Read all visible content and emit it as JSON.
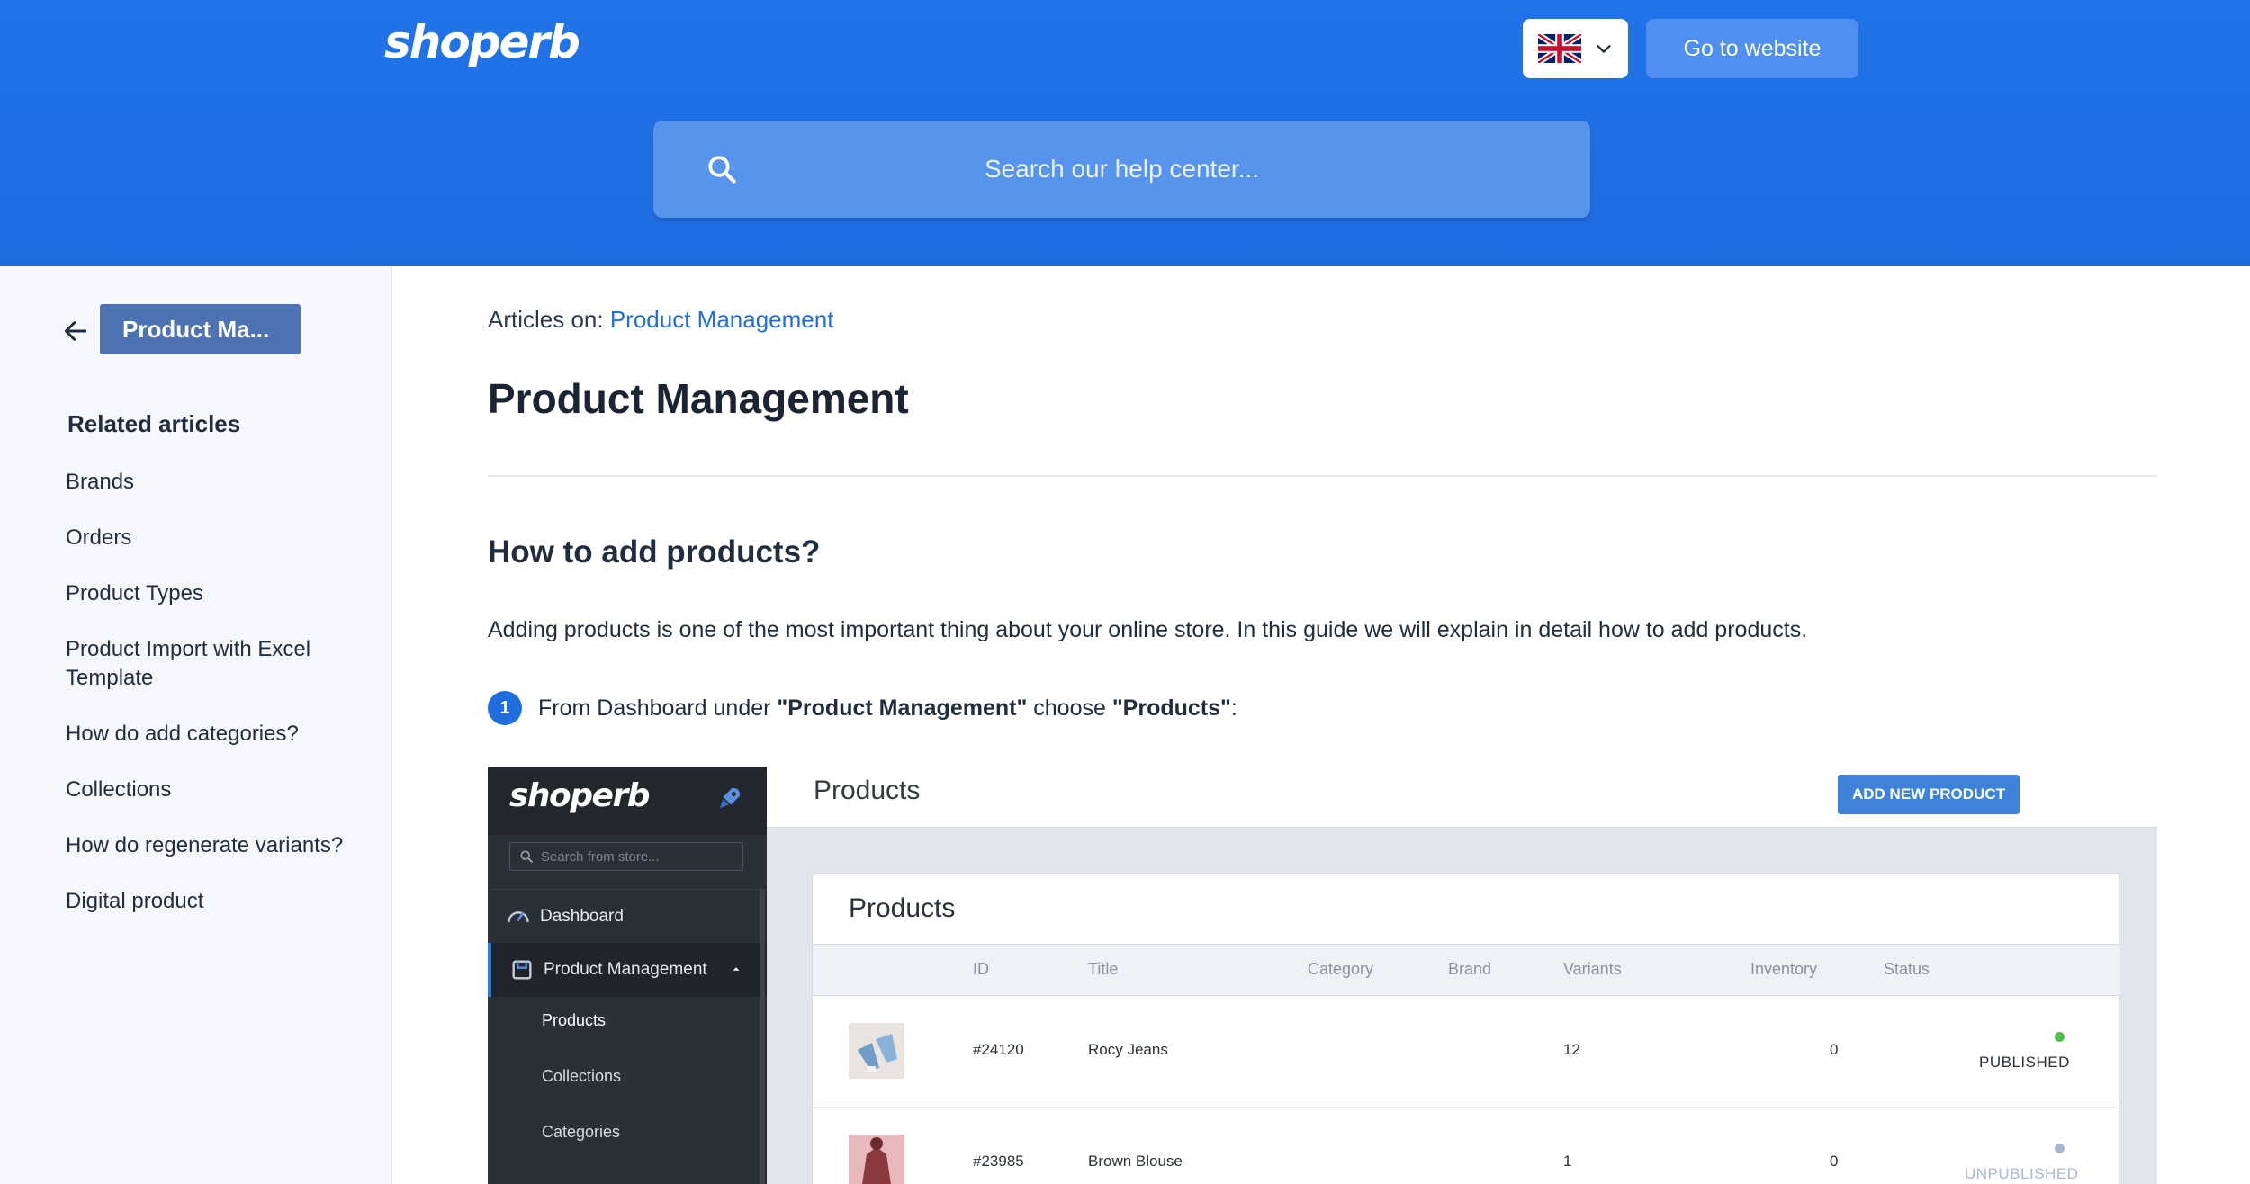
{
  "header": {
    "logo": "shoperb",
    "goto_label": "Go to website",
    "search_placeholder": "Search our help center..."
  },
  "sidebar": {
    "back_label": "Product Ma...",
    "related_title": "Related articles",
    "items": [
      "Brands",
      "Orders",
      "Product Types",
      "Product Import with Excel Template",
      "How do add categories?",
      "Collections",
      "How do regenerate variants?",
      "Digital product"
    ]
  },
  "main": {
    "breadcrumb_prefix": "Articles on: ",
    "breadcrumb_link": "Product Management",
    "title": "Product Management",
    "section_title": "How to add products?",
    "intro": "Adding products is one of the most important thing about your online store. In this guide we will explain in detail how to add products.",
    "step": {
      "number": "1",
      "text_before": "From Dashboard under ",
      "bold1": "\"Product Management\"",
      "text_mid": " choose ",
      "bold2": "\"Products\"",
      "text_after": ":"
    }
  },
  "screenshot": {
    "logo": "shoperb",
    "search_placeholder": "Search from store...",
    "nav": {
      "dashboard": "Dashboard",
      "product_management": "Product Management",
      "sub": [
        "Products",
        "Collections",
        "Categories"
      ]
    },
    "page_heading": "Products",
    "add_button": "ADD NEW PRODUCT",
    "card_title": "Products",
    "columns": [
      "ID",
      "Title",
      "Category",
      "Brand",
      "Variants",
      "Inventory",
      "Status"
    ],
    "rows": [
      {
        "id": "#24120",
        "title": "Rocy Jeans",
        "variants": "12",
        "inventory": "0",
        "status": "PUBLISHED",
        "status_color": "#4cc04c"
      },
      {
        "id": "#23985",
        "title": "Brown Blouse",
        "variants": "1",
        "inventory": "0",
        "status": "UNPUBLISHED",
        "status_color": "#a9b8cc"
      }
    ]
  },
  "colors": {
    "brand_blue": "#1f6ee0",
    "header_bg": "#2173e8",
    "button_blue": "#4f8ff0"
  }
}
